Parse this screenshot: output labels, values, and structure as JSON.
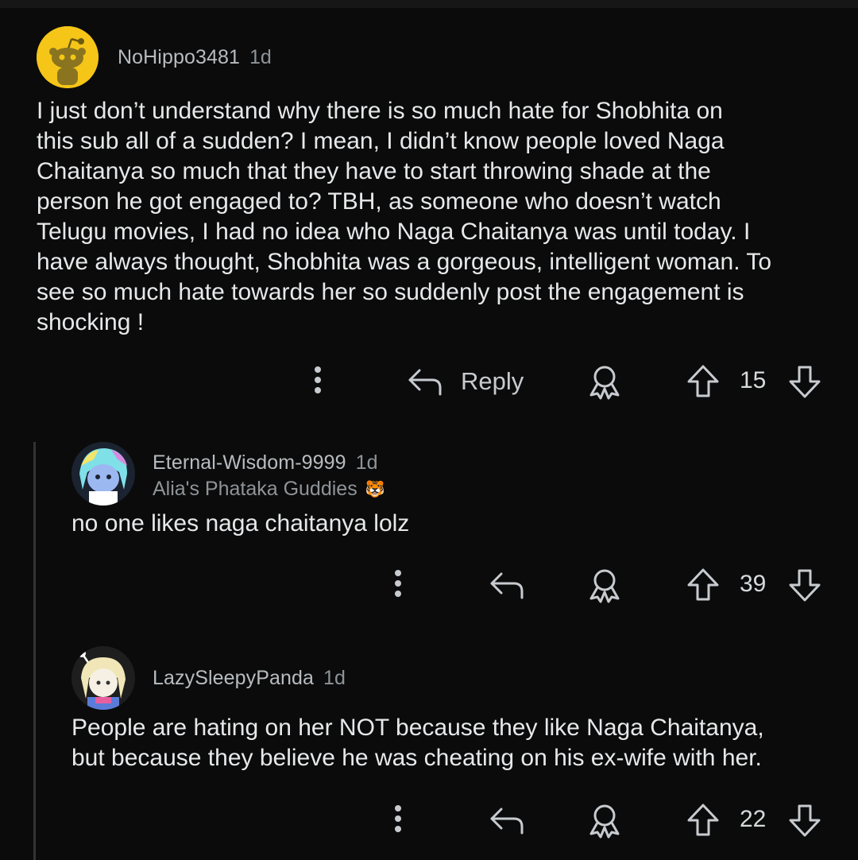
{
  "comments": [
    {
      "author": "NoHippo3481",
      "time": "1d",
      "avatar_icon": "reddit-snoo-avatar",
      "avatar_color": "#f5c518",
      "body": "I just don’t understand why there is so much hate for Shobhita on\nthis sub all of a sudden? I mean, I didn’t know people loved Naga\nChaitanya so much that they have to start throwing shade at the\nperson he got engaged to? TBH, as someone who doesn’t watch\nTelugu movies, I had no idea who Naga Chaitanya was until today. I\nhave always thought, Shobhita was a gorgeous, intelligent woman. To\nsee so much hate towards her so suddenly post the engagement is\nshocking !",
      "reply_label": "Reply",
      "votes": "15"
    },
    {
      "author": "Eternal-Wisdom-9999",
      "time": "1d",
      "flair": "Alia's Phataka Guddies",
      "flair_emoji": "🐯",
      "avatar_icon": "cartoon-avatar-blue-hair",
      "body": "no one likes naga chaitanya lolz",
      "votes": "39"
    },
    {
      "author": "LazySleepyPanda",
      "time": "1d",
      "avatar_icon": "cartoon-avatar-blonde",
      "body": "People are hating on her NOT because they like Naga Chaitanya,\nbut because they believe he was cheating on his ex-wife with her.",
      "votes": "22"
    }
  ],
  "icons": {
    "more": "more-vertical-icon",
    "reply": "reply-arrow-icon",
    "award": "award-icon",
    "upvote": "upvote-arrow-icon",
    "downvote": "downvote-arrow-icon"
  },
  "colors": {
    "background": "#0b0b0b",
    "text": "#e6e8ea",
    "muted": "#8f9498",
    "thread_line": "#333333"
  }
}
